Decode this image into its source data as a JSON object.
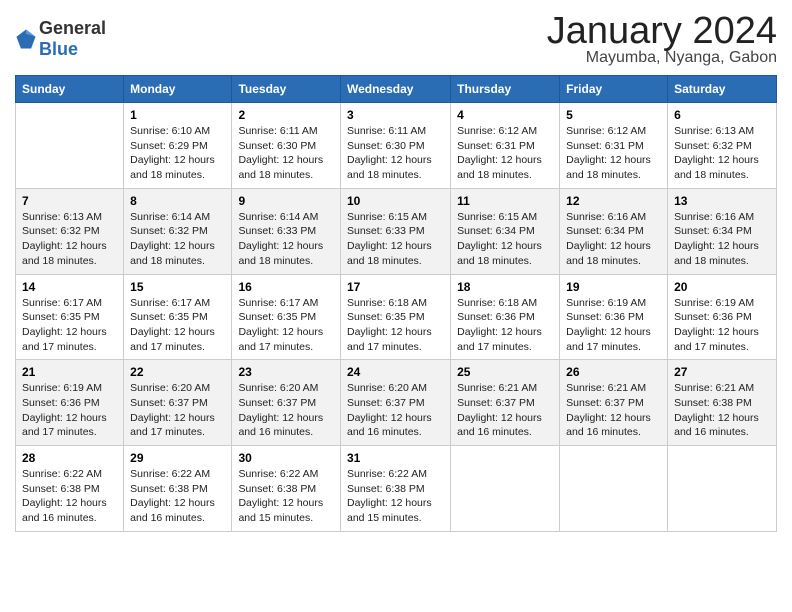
{
  "logo": {
    "general": "General",
    "blue": "Blue"
  },
  "title": "January 2024",
  "location": "Mayumba, Nyanga, Gabon",
  "days_of_week": [
    "Sunday",
    "Monday",
    "Tuesday",
    "Wednesday",
    "Thursday",
    "Friday",
    "Saturday"
  ],
  "weeks": [
    [
      {
        "day": "",
        "info": ""
      },
      {
        "day": "1",
        "info": "Sunrise: 6:10 AM\nSunset: 6:29 PM\nDaylight: 12 hours\nand 18 minutes."
      },
      {
        "day": "2",
        "info": "Sunrise: 6:11 AM\nSunset: 6:30 PM\nDaylight: 12 hours\nand 18 minutes."
      },
      {
        "day": "3",
        "info": "Sunrise: 6:11 AM\nSunset: 6:30 PM\nDaylight: 12 hours\nand 18 minutes."
      },
      {
        "day": "4",
        "info": "Sunrise: 6:12 AM\nSunset: 6:31 PM\nDaylight: 12 hours\nand 18 minutes."
      },
      {
        "day": "5",
        "info": "Sunrise: 6:12 AM\nSunset: 6:31 PM\nDaylight: 12 hours\nand 18 minutes."
      },
      {
        "day": "6",
        "info": "Sunrise: 6:13 AM\nSunset: 6:32 PM\nDaylight: 12 hours\nand 18 minutes."
      }
    ],
    [
      {
        "day": "7",
        "info": "Sunrise: 6:13 AM\nSunset: 6:32 PM\nDaylight: 12 hours\nand 18 minutes."
      },
      {
        "day": "8",
        "info": "Sunrise: 6:14 AM\nSunset: 6:32 PM\nDaylight: 12 hours\nand 18 minutes."
      },
      {
        "day": "9",
        "info": "Sunrise: 6:14 AM\nSunset: 6:33 PM\nDaylight: 12 hours\nand 18 minutes."
      },
      {
        "day": "10",
        "info": "Sunrise: 6:15 AM\nSunset: 6:33 PM\nDaylight: 12 hours\nand 18 minutes."
      },
      {
        "day": "11",
        "info": "Sunrise: 6:15 AM\nSunset: 6:34 PM\nDaylight: 12 hours\nand 18 minutes."
      },
      {
        "day": "12",
        "info": "Sunrise: 6:16 AM\nSunset: 6:34 PM\nDaylight: 12 hours\nand 18 minutes."
      },
      {
        "day": "13",
        "info": "Sunrise: 6:16 AM\nSunset: 6:34 PM\nDaylight: 12 hours\nand 18 minutes."
      }
    ],
    [
      {
        "day": "14",
        "info": "Sunrise: 6:17 AM\nSunset: 6:35 PM\nDaylight: 12 hours\nand 17 minutes."
      },
      {
        "day": "15",
        "info": "Sunrise: 6:17 AM\nSunset: 6:35 PM\nDaylight: 12 hours\nand 17 minutes."
      },
      {
        "day": "16",
        "info": "Sunrise: 6:17 AM\nSunset: 6:35 PM\nDaylight: 12 hours\nand 17 minutes."
      },
      {
        "day": "17",
        "info": "Sunrise: 6:18 AM\nSunset: 6:35 PM\nDaylight: 12 hours\nand 17 minutes."
      },
      {
        "day": "18",
        "info": "Sunrise: 6:18 AM\nSunset: 6:36 PM\nDaylight: 12 hours\nand 17 minutes."
      },
      {
        "day": "19",
        "info": "Sunrise: 6:19 AM\nSunset: 6:36 PM\nDaylight: 12 hours\nand 17 minutes."
      },
      {
        "day": "20",
        "info": "Sunrise: 6:19 AM\nSunset: 6:36 PM\nDaylight: 12 hours\nand 17 minutes."
      }
    ],
    [
      {
        "day": "21",
        "info": "Sunrise: 6:19 AM\nSunset: 6:36 PM\nDaylight: 12 hours\nand 17 minutes."
      },
      {
        "day": "22",
        "info": "Sunrise: 6:20 AM\nSunset: 6:37 PM\nDaylight: 12 hours\nand 17 minutes."
      },
      {
        "day": "23",
        "info": "Sunrise: 6:20 AM\nSunset: 6:37 PM\nDaylight: 12 hours\nand 16 minutes."
      },
      {
        "day": "24",
        "info": "Sunrise: 6:20 AM\nSunset: 6:37 PM\nDaylight: 12 hours\nand 16 minutes."
      },
      {
        "day": "25",
        "info": "Sunrise: 6:21 AM\nSunset: 6:37 PM\nDaylight: 12 hours\nand 16 minutes."
      },
      {
        "day": "26",
        "info": "Sunrise: 6:21 AM\nSunset: 6:37 PM\nDaylight: 12 hours\nand 16 minutes."
      },
      {
        "day": "27",
        "info": "Sunrise: 6:21 AM\nSunset: 6:38 PM\nDaylight: 12 hours\nand 16 minutes."
      }
    ],
    [
      {
        "day": "28",
        "info": "Sunrise: 6:22 AM\nSunset: 6:38 PM\nDaylight: 12 hours\nand 16 minutes."
      },
      {
        "day": "29",
        "info": "Sunrise: 6:22 AM\nSunset: 6:38 PM\nDaylight: 12 hours\nand 16 minutes."
      },
      {
        "day": "30",
        "info": "Sunrise: 6:22 AM\nSunset: 6:38 PM\nDaylight: 12 hours\nand 15 minutes."
      },
      {
        "day": "31",
        "info": "Sunrise: 6:22 AM\nSunset: 6:38 PM\nDaylight: 12 hours\nand 15 minutes."
      },
      {
        "day": "",
        "info": ""
      },
      {
        "day": "",
        "info": ""
      },
      {
        "day": "",
        "info": ""
      }
    ]
  ]
}
